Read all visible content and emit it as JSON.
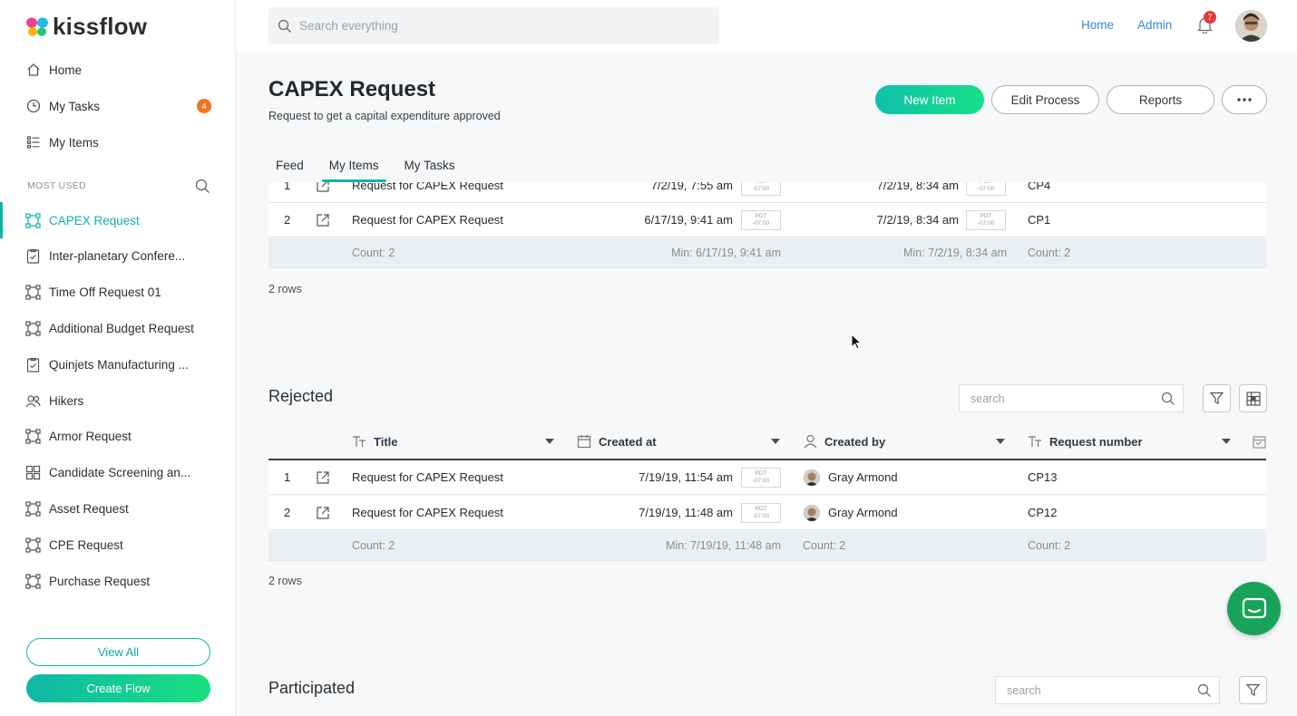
{
  "brand": {
    "name": "kissflow"
  },
  "sidebar": {
    "nav": [
      {
        "label": "Home",
        "icon": "home-icon"
      },
      {
        "label": "My Tasks",
        "icon": "clock-icon",
        "badge": "4"
      },
      {
        "label": "My Items",
        "icon": "list-icon"
      }
    ],
    "section_label": "MOST USED",
    "flows": [
      {
        "label": "CAPEX Request",
        "icon": "flow-icon",
        "active": true
      },
      {
        "label": "Inter-planetary Confere...",
        "icon": "checklist-icon"
      },
      {
        "label": "Time Off Request 01",
        "icon": "flow-icon"
      },
      {
        "label": "Additional Budget Request",
        "icon": "flow-icon"
      },
      {
        "label": "Quinjets Manufacturing ...",
        "icon": "checklist-icon"
      },
      {
        "label": "Hikers",
        "icon": "users-icon"
      },
      {
        "label": "Armor Request",
        "icon": "flow-icon"
      },
      {
        "label": "Candidate Screening an...",
        "icon": "grid-icon"
      },
      {
        "label": "Asset Request",
        "icon": "flow-icon"
      },
      {
        "label": "CPE Request",
        "icon": "flow-icon"
      },
      {
        "label": "Purchase Request",
        "icon": "flow-icon"
      }
    ],
    "view_all": "View All",
    "create_flow": "Create Flow"
  },
  "topbar": {
    "search_placeholder": "Search everything",
    "home": "Home",
    "admin": "Admin",
    "notifications": "7"
  },
  "page": {
    "title": "CAPEX Request",
    "subtitle": "Request to get a capital expenditure approved",
    "new_item": "New Item",
    "edit_process": "Edit Process",
    "reports": "Reports",
    "tabs": [
      "Feed",
      "My Items",
      "My Tasks"
    ]
  },
  "tz": {
    "line1": "PDT",
    "line2": "-07:00"
  },
  "table1": {
    "rows": [
      {
        "num": "1",
        "title": "Request for CAPEX Request",
        "created": "7/2/19, 7:55 am",
        "modified": "7/2/19, 8:34 am",
        "request": "CP4"
      },
      {
        "num": "2",
        "title": "Request for CAPEX Request",
        "created": "6/17/19, 9:41 am",
        "modified": "7/2/19, 8:34 am",
        "request": "CP1"
      }
    ],
    "footer": {
      "count": "Count: 2",
      "min1": "Min: 6/17/19, 9:41 am",
      "min2": "Min: 7/2/19, 8:34 am",
      "count2": "Count: 2"
    },
    "rows_label": "2 rows"
  },
  "rejected": {
    "title": "Rejected",
    "search_placeholder": "search",
    "columns": [
      "Title",
      "Created at",
      "Created by",
      "Request number"
    ],
    "rows": [
      {
        "num": "1",
        "title": "Request for CAPEX Request",
        "created": "7/19/19, 11:54 am",
        "by": "Gray Armond",
        "request": "CP13"
      },
      {
        "num": "2",
        "title": "Request for CAPEX Request",
        "created": "7/19/19, 11:48 am",
        "by": "Gray Armond",
        "request": "CP12"
      }
    ],
    "footer": {
      "count": "Count: 2",
      "min": "Min: 7/19/19, 11:48 am",
      "count_by": "Count: 2",
      "count_req": "Count: 2"
    },
    "rows_label": "2 rows"
  },
  "participated": {
    "title": "Participated",
    "search_placeholder": "search"
  }
}
